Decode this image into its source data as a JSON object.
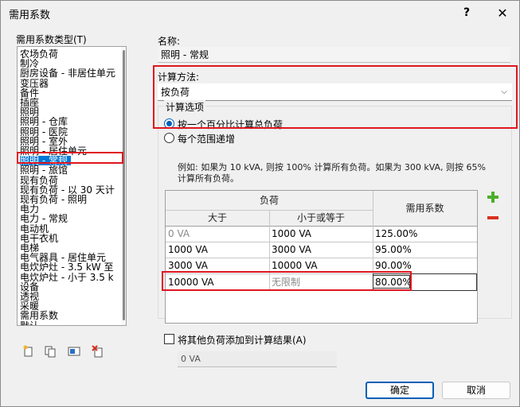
{
  "window": {
    "title": "需用系数",
    "help": "?",
    "close": "✕"
  },
  "left": {
    "label": "需用系数类型(T)",
    "items": [
      "农场负荷",
      "制冷",
      "厨房设备 - 非居住单元",
      "变压器",
      "备件",
      "插座",
      "照明",
      "照明 - 仓库",
      "照明 - 医院",
      "照明 - 室外",
      "照明 - 居住单元",
      "照明 - 常规",
      "照明 - 旅馆",
      "现有负荷",
      "现有负荷 - 以 30 天计",
      "现有负荷 - 照明",
      "电力",
      "电力 - 常规",
      "电动机",
      "电干衣机",
      "电梯",
      "电气器具 - 居住单元",
      "电炊炉灶 - 3.5 kW 至",
      "电炊炉灶 - 小于 3.5 k",
      "设备",
      "透视",
      "采暖",
      "需用系数",
      "默认"
    ],
    "selected_index": 11,
    "tools": [
      "new-type-icon",
      "duplicate-icon",
      "rename-icon",
      "delete-icon"
    ]
  },
  "right": {
    "name_label": "名称:",
    "name_value": "照明 - 常规",
    "method_label": "计算方法:",
    "method_value": "按负荷",
    "options_label": "计算选项",
    "radio1": "按一个百分比计算总负荷",
    "radio2": "每个范围递增",
    "example": "例如: 如果为 10 kVA, 则按 100% 计算所有负荷。如果为 300 kVA, 则按 65% 计算所有负荷。",
    "table": {
      "group_header": "负荷",
      "col_gt": "大于",
      "col_le": "小于或等于",
      "col_factor": "需用系数",
      "rows": [
        {
          "gt": "0 VA",
          "le": "1000 VA",
          "factor": "125.00%"
        },
        {
          "gt": "1000 VA",
          "le": "3000 VA",
          "factor": "95.00%"
        },
        {
          "gt": "3000 VA",
          "le": "10000 VA",
          "factor": "90.00%"
        },
        {
          "gt": "10000 VA",
          "le": "无限制",
          "factor": "80.00%"
        }
      ]
    },
    "checkbox_label": "将其他负荷添加到计算结果(A)",
    "extra_value": "0 VA"
  },
  "buttons": {
    "ok": "确定",
    "cancel": "取消"
  },
  "colors": {
    "accent": "#005fb8",
    "highlight": "#e0161f",
    "add": "#4caf2a",
    "remove": "#d9301e"
  }
}
